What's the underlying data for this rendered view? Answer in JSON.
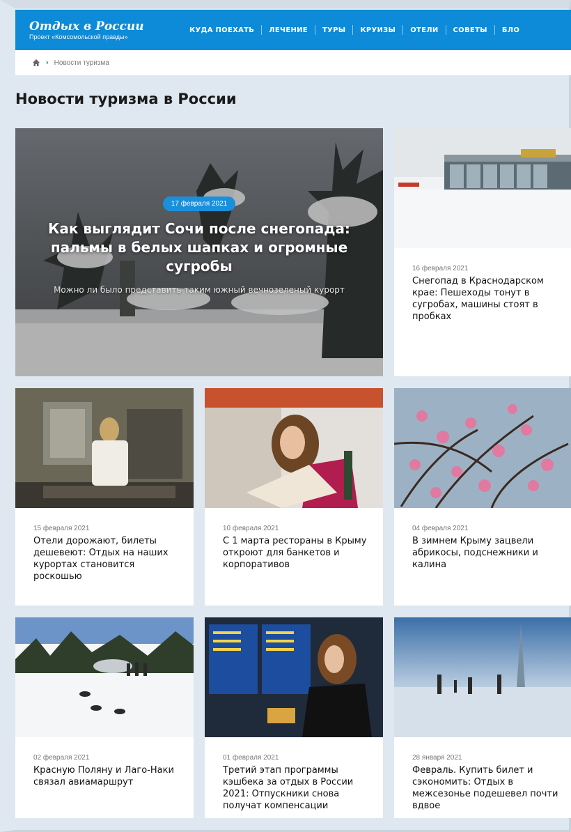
{
  "header": {
    "logo_title": "Отдых в России",
    "logo_sub": "Проект «Комсомольской правды»",
    "nav": [
      "КУДА ПОЕХАТЬ",
      "ЛЕЧЕНИЕ",
      "ТУРЫ",
      "КРУИЗЫ",
      "ОТЕЛИ",
      "СОВЕТЫ",
      "БЛО"
    ]
  },
  "breadcrumb": {
    "home_icon": "home-icon",
    "current": "Новости туризма"
  },
  "page_title": "Новости туризма в России",
  "featured": {
    "date": "17 февраля 2021",
    "title": "Как выглядит Сочи после снегопада: пальмы в белых шапках и огромные сугробы",
    "subtitle": "Можно ли было представить таким южный вечнозеленый курорт"
  },
  "articles": [
    {
      "date": "16 февраля 2021",
      "title": "Снегопад в Краснодарском крае: Пешеходы тонут в сугробах, машины стоят в пробках"
    },
    {
      "date": "15 февраля 2021",
      "title": "Отели дорожают, билеты дешевеют: Отдых на наших курортах становится роскошью"
    },
    {
      "date": "10 февраля 2021",
      "title": "С 1 марта рестораны в Крыму откроют для банкетов и корпоративов"
    },
    {
      "date": "04 февраля 2021",
      "title": "В зимнем Крыму зацвели абрикосы, подснежники и калина"
    },
    {
      "date": "02 февраля 2021",
      "title": "Красную Поляну и Лаго-Наки связал авиамаршрут"
    },
    {
      "date": "01 февраля 2021",
      "title": "Третий этап программы кэшбека за отдых в России 2021: Отпускники снова получат компенсации"
    },
    {
      "date": "28 января 2021",
      "title": "Февраль. Купить билет и сэкономить: Отдых в межсезонье подешевел почти вдвое"
    }
  ],
  "colors": {
    "brand": "#0d8ad8",
    "page_bg": "#dfe8f0",
    "badge": "#1a8fdc"
  }
}
